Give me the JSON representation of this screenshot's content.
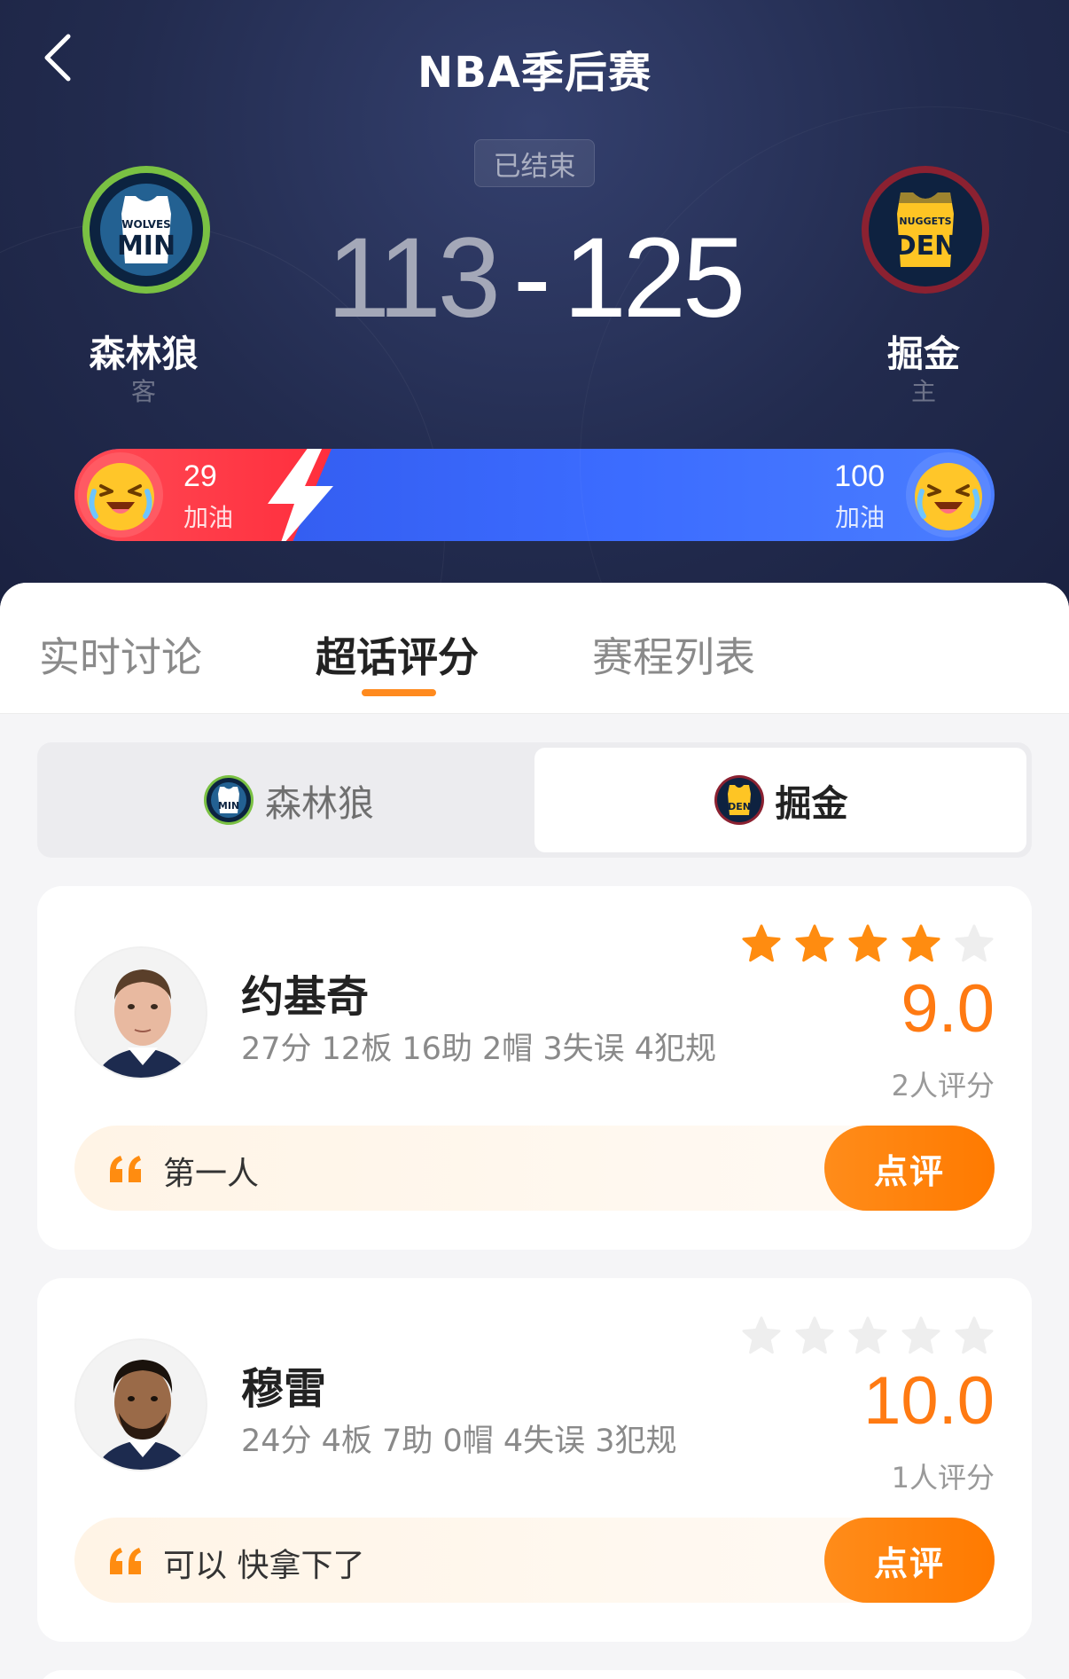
{
  "nav": {
    "title": "NBA季后赛"
  },
  "match": {
    "status": "已结束",
    "away_score": "113",
    "home_score": "125",
    "separator": "-",
    "away_team": {
      "name": "森林狼",
      "role": "客",
      "logo_text_top": "WOLVES",
      "logo_text": "MIN"
    },
    "home_team": {
      "name": "掘金",
      "role": "主",
      "logo_text_top": "NUGGETS",
      "logo_text": "DEN"
    }
  },
  "cheer": {
    "away_count": "29",
    "away_label": "加油",
    "home_count": "100",
    "home_label": "加油"
  },
  "tabs": [
    {
      "label": "实时讨论",
      "active": false
    },
    {
      "label": "超话评分",
      "active": true
    },
    {
      "label": "赛程列表",
      "active": false
    }
  ],
  "team_switch": {
    "min_label": "森林狼",
    "den_label": "掘金",
    "selected": "den"
  },
  "players": [
    {
      "name": "约基奇",
      "stats": "27分 12板 16助 2帽 3失误 4犯规",
      "stars_filled": 4,
      "stars_total": 5,
      "rating": "9.0",
      "rating_count": "2人评分",
      "comment": "第一人",
      "review_label": "点评"
    },
    {
      "name": "穆雷",
      "stats": "24分 4板 7助 0帽 4失误 3犯规",
      "stars_filled": 0,
      "stars_total": 5,
      "rating": "10.0",
      "rating_count": "1人评分",
      "comment": "可以 快拿下了",
      "review_label": "点评"
    }
  ],
  "colors": {
    "accent_orange": "#ff7a12",
    "away_red": "#ff2e3d",
    "home_blue": "#3c6cff",
    "hero_bg": "#222b4e"
  },
  "icons": {
    "back": "chevron-left-icon",
    "bolt": "lightning-icon",
    "star": "star-icon",
    "quote": "quote-icon",
    "cheer_emoji": "laughing-emoji-icon"
  }
}
